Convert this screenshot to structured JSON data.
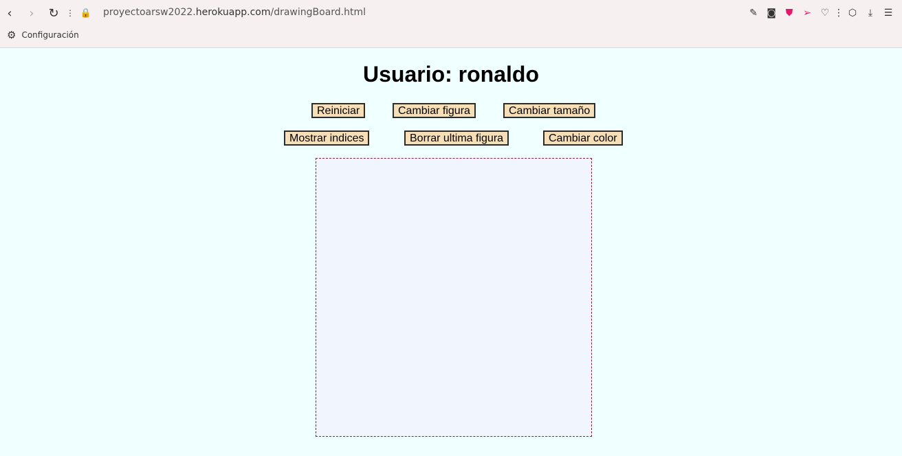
{
  "browser": {
    "url_prefix": "proyectoarsw2022.",
    "url_host": "herokuapp.com",
    "url_path": "/drawingBoard.html",
    "bookmark_label": "Configuración"
  },
  "page": {
    "title": "Usuario: ronaldo",
    "buttons": {
      "reiniciar": "Reiniciar",
      "cambiar_figura": "Cambiar figura",
      "cambiar_tamano": "Cambiar tamaño",
      "mostrar_indices": "Mostrar indices",
      "borrar_ultima": "Borrar ultima figura",
      "cambiar_color": "Cambiar color"
    },
    "colors": {
      "background": "#f0ffff",
      "button_bg": "#f6deb6",
      "canvas_border": "#8a1f3c",
      "canvas_bg": "#f1f6fe"
    }
  }
}
